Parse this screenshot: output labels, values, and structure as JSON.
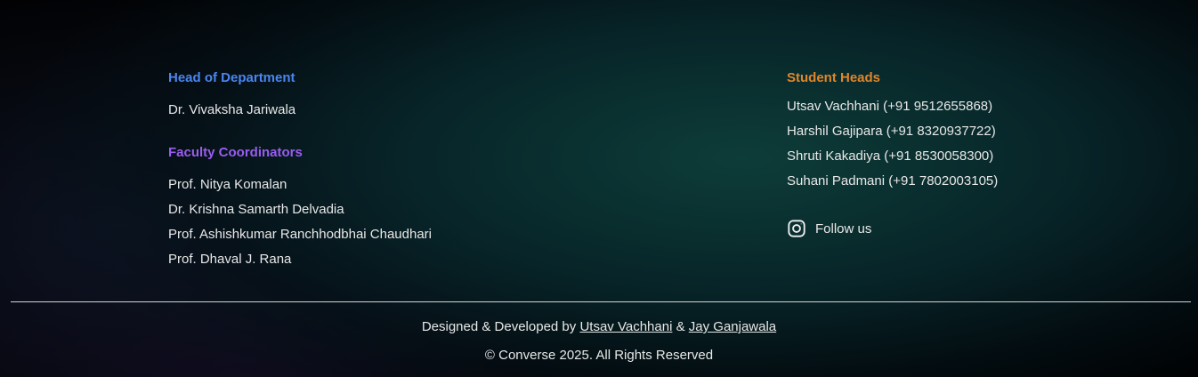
{
  "hod": {
    "title": "Head of Department",
    "names": [
      "Dr. Vivaksha Jariwala"
    ]
  },
  "faculty": {
    "title": "Faculty Coordinators",
    "names": [
      "Prof. Nitya Komalan",
      "Dr. Krishna Samarth Delvadia",
      "Prof. Ashishkumar Ranchhodbhai Chaudhari",
      "Prof. Dhaval J. Rana"
    ]
  },
  "students": {
    "title": "Student Heads",
    "names": [
      "Utsav Vachhani (+91 9512655868)",
      "Harshil Gajipara (+91 8320937722)",
      "Shruti Kakadiya (+91 8530058300)",
      "Suhani Padmani (+91 7802003105)"
    ]
  },
  "social": {
    "icon": "instagram-icon",
    "label": "Follow us"
  },
  "footer": {
    "designed_prefix": "Designed & Developed by",
    "dev1": "Utsav Vachhani",
    "amp": "&",
    "dev2": "Jay Ganjawala",
    "copyright": "© Converse 2025. All Rights Reserved"
  },
  "colors": {
    "hod_heading": "#4a86f0",
    "faculty_heading": "#9a5cf0",
    "students_heading": "#e0862a"
  }
}
